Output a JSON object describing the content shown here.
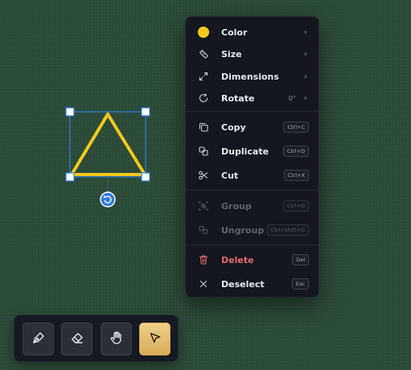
{
  "canvas": {
    "shape": "triangle",
    "stroke_color": "#f2c81e",
    "selection_color": "#2f7bdc",
    "rotate_handle_icon": "rotate-handle-icon"
  },
  "context_menu": {
    "color": {
      "label": "Color",
      "swatch": "#f2c81e",
      "icon": "color-swatch-icon"
    },
    "size": {
      "label": "Size",
      "icon": "ruler-icon"
    },
    "dimensions": {
      "label": "Dimensions",
      "icon": "resize-arrows-icon"
    },
    "rotate": {
      "label": "Rotate",
      "value": "0°",
      "icon": "rotate-icon"
    },
    "copy": {
      "label": "Copy",
      "shortcut": "Ctrl+C",
      "icon": "copy-icon"
    },
    "duplicate": {
      "label": "Duplicate",
      "shortcut": "Ctrl+D",
      "icon": "duplicate-icon"
    },
    "cut": {
      "label": "Cut",
      "shortcut": "Ctrl+X",
      "icon": "scissors-icon"
    },
    "group": {
      "label": "Group",
      "shortcut": "Ctrl+G",
      "icon": "group-icon"
    },
    "ungroup": {
      "label": "Ungroup",
      "shortcut": "Ctrl+Shift+G",
      "icon": "ungroup-icon"
    },
    "delete": {
      "label": "Delete",
      "shortcut": "Del",
      "icon": "trash-icon",
      "color": "#e46a6a"
    },
    "deselect": {
      "label": "Deselect",
      "shortcut": "Esc",
      "icon": "close-icon"
    }
  },
  "toolbar": {
    "tools": [
      {
        "name": "pen",
        "icon": "pen-icon"
      },
      {
        "name": "eraser",
        "icon": "eraser-icon"
      },
      {
        "name": "hand",
        "icon": "hand-icon"
      },
      {
        "name": "select",
        "icon": "cursor-icon",
        "active": true
      }
    ],
    "accent": "#e3bd6e"
  }
}
